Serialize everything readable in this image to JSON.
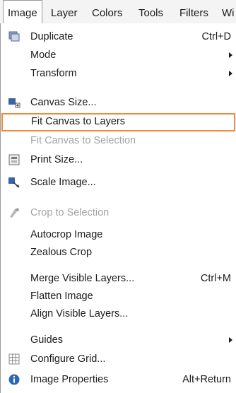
{
  "menubar": {
    "items": [
      "Image",
      "Layer",
      "Colors",
      "Tools",
      "Filters",
      "Wi"
    ]
  },
  "menu": {
    "duplicate": {
      "label": "Duplicate",
      "shortcut": "Ctrl+D"
    },
    "mode": {
      "label": "Mode"
    },
    "transform": {
      "label": "Transform"
    },
    "canvas_size": {
      "label": "Canvas Size..."
    },
    "fit_canvas_layers": {
      "label": "Fit Canvas to Layers"
    },
    "fit_canvas_selection": {
      "label": "Fit Canvas to Selection"
    },
    "print_size": {
      "label": "Print Size..."
    },
    "scale_image": {
      "label": "Scale Image..."
    },
    "crop_selection": {
      "label": "Crop to Selection"
    },
    "autocrop": {
      "label": "Autocrop Image"
    },
    "zealous_crop": {
      "label": "Zealous Crop"
    },
    "merge_visible": {
      "label": "Merge Visible Layers...",
      "shortcut": "Ctrl+M"
    },
    "flatten": {
      "label": "Flatten Image"
    },
    "align_visible": {
      "label": "Align Visible Layers..."
    },
    "guides": {
      "label": "Guides"
    },
    "configure_grid": {
      "label": "Configure Grid..."
    },
    "image_properties": {
      "label": "Image Properties",
      "shortcut": "Alt+Return"
    }
  },
  "colors": {
    "highlight_border": "#f08a3c",
    "disabled_text": "#a3a3a3"
  }
}
